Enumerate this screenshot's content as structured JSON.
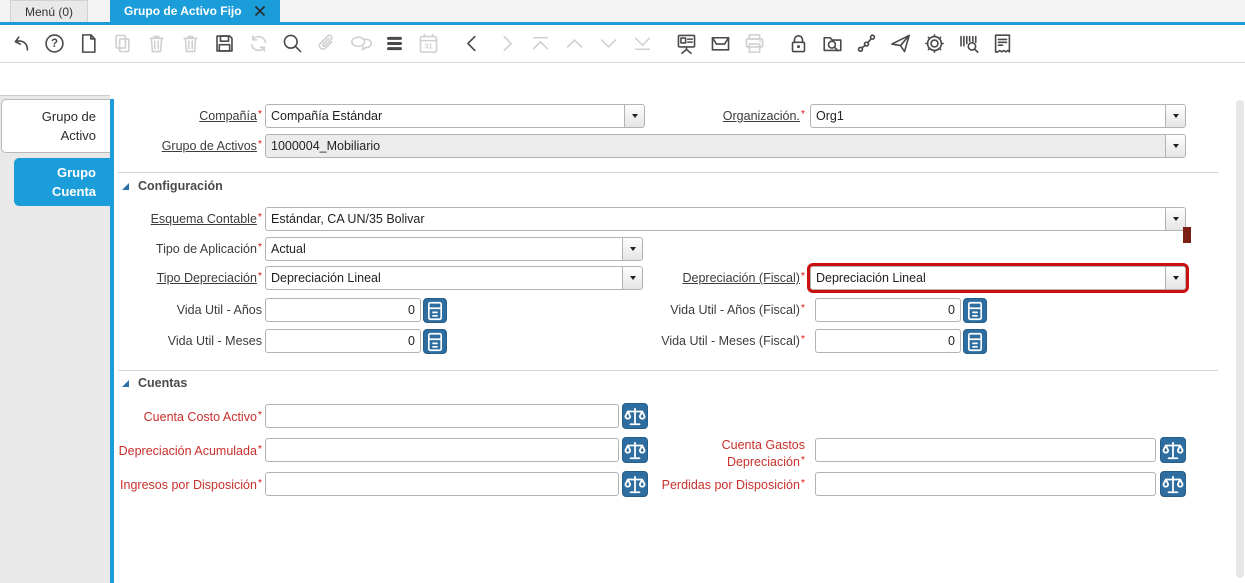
{
  "window_tabs": {
    "menu": {
      "label": "Menú (0)"
    },
    "active": {
      "label": "Grupo de Activo Fijo"
    }
  },
  "toolbar": {
    "icons": [
      {
        "name": "undo",
        "enabled": true
      },
      {
        "name": "help",
        "enabled": true
      },
      {
        "name": "new-record",
        "enabled": true
      },
      {
        "name": "copy-record",
        "enabled": false
      },
      {
        "name": "delete-record",
        "enabled": false
      },
      {
        "name": "delete-selection",
        "enabled": false
      },
      {
        "name": "save",
        "enabled": true
      },
      {
        "name": "refresh",
        "enabled": false
      },
      {
        "name": "find",
        "enabled": true
      },
      {
        "name": "attachment",
        "enabled": false
      },
      {
        "name": "chat",
        "enabled": false
      },
      {
        "name": "list-view",
        "enabled": true
      },
      {
        "name": "calendar",
        "enabled": false
      },
      {
        "name": "nav-previous",
        "enabled": true
      },
      {
        "name": "nav-next",
        "enabled": false
      },
      {
        "name": "nav-first",
        "enabled": false
      },
      {
        "name": "nav-up",
        "enabled": false
      },
      {
        "name": "nav-down",
        "enabled": false
      },
      {
        "name": "nav-last",
        "enabled": false
      },
      {
        "name": "report",
        "enabled": true
      },
      {
        "name": "archive",
        "enabled": true
      },
      {
        "name": "print",
        "enabled": false
      },
      {
        "name": "lock",
        "enabled": true
      },
      {
        "name": "record-search",
        "enabled": true
      },
      {
        "name": "workflow",
        "enabled": true
      },
      {
        "name": "send",
        "enabled": true
      },
      {
        "name": "settings",
        "enabled": true
      },
      {
        "name": "product-search",
        "enabled": true
      },
      {
        "name": "document",
        "enabled": true
      }
    ]
  },
  "sidebar": {
    "tabs": [
      {
        "label": "Grupo de Activo"
      },
      {
        "label": "Grupo Cuenta"
      }
    ]
  },
  "form": {
    "required_marker": "*",
    "sections": {
      "configuracion": "Configuración",
      "cuentas": "Cuentas"
    },
    "fields": {
      "compania": {
        "label": "Compañía",
        "value": "Compañía Estándar"
      },
      "organizacion": {
        "label": "Organización.",
        "value": "Org1"
      },
      "grupo_activos": {
        "label": "Grupo de Activos",
        "value": "1000004_Mobiliario"
      },
      "esquema_contable": {
        "label": "Esquema Contable",
        "value": "Estándar, CA UN/35 Bolivar"
      },
      "tipo_aplicacion": {
        "label": "Tipo de Aplicación",
        "value": "Actual"
      },
      "tipo_depreciacion": {
        "label": "Tipo Depreciación",
        "value": "Depreciación Lineal"
      },
      "depreciacion_fiscal": {
        "label": "Depreciación (Fiscal)",
        "value": "Depreciación Lineal"
      },
      "vida_util_anos": {
        "label": "Vida Util - Años",
        "value": "0"
      },
      "vida_util_anos_fiscal": {
        "label": "Vida Util - Años (Fiscal)",
        "value": "0"
      },
      "vida_util_meses": {
        "label": "Vida Util - Meses",
        "value": "0"
      },
      "vida_util_meses_fiscal": {
        "label": "Vida Util - Meses (Fiscal)",
        "value": "0"
      },
      "cuenta_costo_activo": {
        "label": "Cuenta Costo Activo",
        "value": ""
      },
      "depreciacion_acumulada": {
        "label": "Depreciación Acumulada",
        "value": ""
      },
      "cuenta_gastos_depreciacion": {
        "label": "Cuenta Gastos Depreciación",
        "value": ""
      },
      "ingresos_disposicion": {
        "label": "Ingresos por Disposición",
        "value": ""
      },
      "perdidas_disposicion": {
        "label": "Perdidas por Disposición",
        "value": ""
      }
    }
  },
  "colors": {
    "accent_blue": "#1b9dd9",
    "button_blue": "#2d6d9f",
    "highlight_red": "#cb1010",
    "mandatory_red": "#c9302c"
  }
}
